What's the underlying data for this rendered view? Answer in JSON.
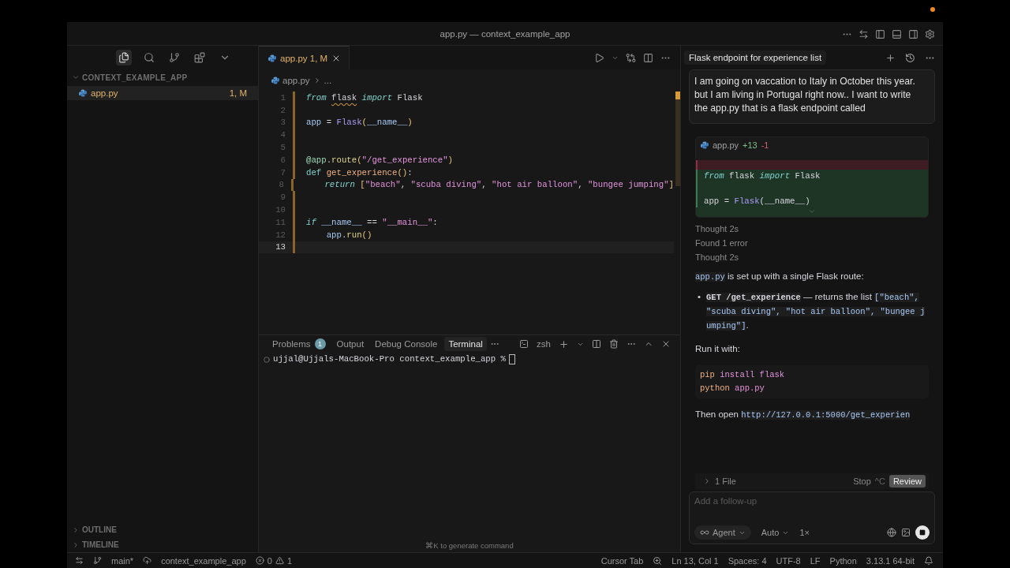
{
  "window": {
    "title": "app.py — context_example_app"
  },
  "activity_bar": [
    {
      "kind": "explorer",
      "selected": true
    },
    {
      "kind": "search",
      "selected": false
    },
    {
      "kind": "source-control",
      "selected": false
    },
    {
      "kind": "extensions",
      "selected": false
    },
    {
      "kind": "more",
      "selected": false
    }
  ],
  "explorer": {
    "folder": "CONTEXT_EXAMPLE_APP",
    "expanded": true,
    "files": [
      {
        "name": "app.py",
        "badge": "1, M",
        "selected": true
      }
    ]
  },
  "sections": [
    {
      "label": "OUTLINE",
      "expanded": false
    },
    {
      "label": "TIMELINE",
      "expanded": false
    }
  ],
  "editor": {
    "tabs": [
      {
        "name": "app.py",
        "badge": "1, M",
        "selected": true
      }
    ],
    "breadcrumb": [
      "app.py",
      "..."
    ],
    "lines": [
      {
        "number": "1",
        "current": false,
        "tokens": [
          {
            "kind": "keyword",
            "text": "from "
          },
          {
            "kind": "warning",
            "text": "flask"
          },
          {
            "kind": "keyword",
            "text": " import"
          },
          {
            "kind": "plain",
            "text": " Flask"
          }
        ]
      },
      {
        "number": "2",
        "current": false
      },
      {
        "number": "3",
        "current": false,
        "tokens": [
          {
            "kind": "variable",
            "text": "app"
          },
          {
            "kind": "plain",
            "text": " = "
          },
          {
            "kind": "call",
            "text": "Flask"
          },
          {
            "kind": "punct",
            "text": "("
          },
          {
            "kind": "variable",
            "text": "__name__"
          },
          {
            "kind": "punct",
            "text": ")"
          }
        ]
      },
      {
        "number": "4",
        "current": false
      },
      {
        "number": "5",
        "current": false
      },
      {
        "number": "6",
        "current": false,
        "tokens": [
          {
            "kind": "decorator",
            "text": "@app"
          },
          {
            "kind": "plain",
            "text": "."
          },
          {
            "kind": "method",
            "text": "route"
          },
          {
            "kind": "punct",
            "text": "("
          },
          {
            "kind": "string",
            "text": "\"/get_experience\""
          },
          {
            "kind": "punct",
            "text": ")"
          }
        ]
      },
      {
        "number": "7",
        "current": false,
        "tokens": [
          {
            "kind": "def",
            "text": "def "
          },
          {
            "kind": "function",
            "text": "get_experience"
          },
          {
            "kind": "punct",
            "text": "()"
          },
          {
            "kind": "plain",
            "text": ":"
          }
        ]
      },
      {
        "number": "8",
        "current": false,
        "tokens": [
          {
            "kind": "keyword",
            "text": "    return "
          },
          {
            "kind": "punct",
            "text": "["
          },
          {
            "kind": "string",
            "text": "\"beach\""
          },
          {
            "kind": "plain",
            "text": ", "
          },
          {
            "kind": "string",
            "text": "\"scuba diving\""
          },
          {
            "kind": "plain",
            "text": ", "
          },
          {
            "kind": "string",
            "text": "\"hot air balloon\""
          },
          {
            "kind": "plain",
            "text": ", "
          },
          {
            "kind": "string",
            "text": "\"bungee jumping\""
          },
          {
            "kind": "punct",
            "text": "]"
          }
        ]
      },
      {
        "number": "9",
        "current": false
      },
      {
        "number": "10",
        "current": false
      },
      {
        "number": "11",
        "current": false,
        "tokens": [
          {
            "kind": "keyword",
            "text": "if "
          },
          {
            "kind": "variable",
            "text": "__name__"
          },
          {
            "kind": "plain",
            "text": " == "
          },
          {
            "kind": "string",
            "text": "\"__main__\""
          },
          {
            "kind": "plain",
            "text": ":"
          }
        ]
      },
      {
        "number": "12",
        "current": false,
        "tokens": [
          {
            "kind": "variable",
            "text": "    app"
          },
          {
            "kind": "plain",
            "text": "."
          },
          {
            "kind": "method",
            "text": "run"
          },
          {
            "kind": "punct",
            "text": "()"
          }
        ]
      },
      {
        "number": "13",
        "current": true
      }
    ]
  },
  "panel": {
    "tabs": [
      {
        "label": "Problems",
        "count": "1",
        "selected": false
      },
      {
        "label": "Output",
        "selected": false
      },
      {
        "label": "Debug Console",
        "selected": false
      },
      {
        "label": "Terminal",
        "selected": true
      }
    ],
    "shell": "zsh",
    "prompt": "ujjal@Ujjals-MacBook-Pro context_example_app %",
    "hint": "⌘K to generate command"
  },
  "chat": {
    "title": "Flask endpoint for experience list",
    "prompt": "I am going on vaccation to Italy in October this year. but I am living in Portugal right now.. I want to write the app.py that is a flask endpoint called",
    "diff": {
      "file": "app.py",
      "added": "+13",
      "removed": "-1",
      "lines": [
        {
          "kind": "removed"
        },
        {
          "kind": "added",
          "tokens": [
            {
              "kind": "keyword",
              "text": "from"
            },
            {
              "kind": "plain",
              "text": " flask "
            },
            {
              "kind": "keyword",
              "text": "import"
            },
            {
              "kind": "plain",
              "text": " Flask"
            }
          ]
        },
        {
          "kind": "added"
        },
        {
          "kind": "added",
          "tokens": [
            {
              "kind": "plain",
              "text": "app = "
            },
            {
              "kind": "call",
              "text": "Flask"
            },
            {
              "kind": "plain",
              "text": "(__name__)"
            }
          ]
        }
      ]
    },
    "steps": [
      "Thought 2s",
      "Found 1 error",
      "Thought 2s"
    ],
    "summary": [
      {
        "kind": "code",
        "t": "app.py"
      },
      {
        "kind": "text",
        "t": " is set up with a single Flask route:"
      }
    ],
    "bullets": [
      {
        "marker": "•",
        "segments": [
          {
            "kind": "strong-code",
            "t": "GET /get_experience"
          },
          {
            "kind": "text",
            "t": " — returns the list "
          },
          {
            "kind": "code",
            "t": "[\"beach\", \"scuba diving\", \"hot air balloon\", \"bungee jumping\"]"
          },
          {
            "kind": "text",
            "t": "."
          }
        ]
      }
    ],
    "run_label": "Run it with:",
    "commands": [
      [
        {
          "kind": "function",
          "text": "pip"
        },
        {
          "kind": "string",
          "text": " install flask"
        }
      ],
      [
        {
          "kind": "function",
          "text": "python"
        },
        {
          "kind": "string",
          "text": " app.py"
        }
      ]
    ],
    "open": [
      {
        "kind": "text",
        "t": "Then open "
      },
      {
        "kind": "code",
        "t": "http://127.0.0.1:5000/get_experien"
      }
    ],
    "footer": {
      "files": "1 File",
      "stop": "Stop",
      "stop_key": "^C",
      "review": "Review"
    },
    "input": {
      "placeholder": "Add a follow-up",
      "mode": "Agent",
      "model": "Auto",
      "multiplier": "1×"
    }
  },
  "status_bar": {
    "branch": "main*",
    "folder": "context_example_app",
    "errors": "0",
    "warnings": "1",
    "cursor_tab": "Cursor Tab",
    "items": [
      "Ln 13, Col 1",
      "Spaces: 4",
      "UTF-8",
      "LF",
      "Python",
      "3.13.1 64-bit"
    ]
  }
}
